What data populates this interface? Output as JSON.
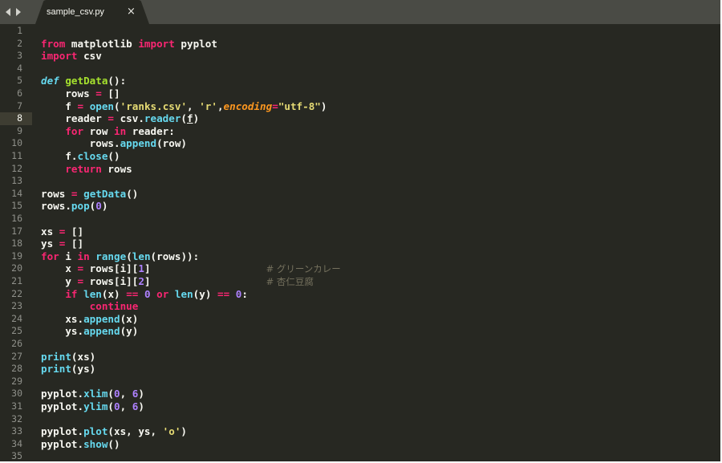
{
  "tab": {
    "filename": "sample_csv.py",
    "close_glyph": "×"
  },
  "editor": {
    "current_line": 8,
    "lines": [
      [],
      [
        [
          "kw",
          "from"
        ],
        [
          "tx",
          " matplotlib "
        ],
        [
          "kw",
          "import"
        ],
        [
          "tx",
          " pyplot"
        ]
      ],
      [
        [
          "kw",
          "import"
        ],
        [
          "tx",
          " csv"
        ]
      ],
      [],
      [
        [
          "df",
          "def"
        ],
        [
          "tx",
          " "
        ],
        [
          "dn",
          "getData"
        ],
        [
          "tx",
          "():"
        ]
      ],
      [
        [
          "tx",
          "    rows "
        ],
        [
          "kw",
          "="
        ],
        [
          "tx",
          " []"
        ]
      ],
      [
        [
          "tx",
          "    f "
        ],
        [
          "kw",
          "="
        ],
        [
          "tx",
          " "
        ],
        [
          "fn",
          "open"
        ],
        [
          "tx",
          "("
        ],
        [
          "st",
          "'ranks.csv'"
        ],
        [
          "tx",
          ", "
        ],
        [
          "st",
          "'r'"
        ],
        [
          "tx",
          ","
        ],
        [
          "pa",
          "encoding"
        ],
        [
          "kw",
          "="
        ],
        [
          "st",
          "\"utf-8\""
        ],
        [
          "tx",
          ")"
        ]
      ],
      [
        [
          "tx",
          "    reader "
        ],
        [
          "kw",
          "="
        ],
        [
          "tx",
          " csv."
        ],
        [
          "fn",
          "reader"
        ],
        [
          "tx",
          "("
        ],
        [
          "ul",
          "f"
        ],
        [
          "tx",
          ")"
        ]
      ],
      [
        [
          "tx",
          "    "
        ],
        [
          "kw",
          "for"
        ],
        [
          "tx",
          " row "
        ],
        [
          "kw",
          "in"
        ],
        [
          "tx",
          " reader:"
        ]
      ],
      [
        [
          "tx",
          "        rows."
        ],
        [
          "fn",
          "append"
        ],
        [
          "tx",
          "(row)"
        ]
      ],
      [
        [
          "tx",
          "    f."
        ],
        [
          "fn",
          "close"
        ],
        [
          "tx",
          "()"
        ]
      ],
      [
        [
          "tx",
          "    "
        ],
        [
          "kw",
          "return"
        ],
        [
          "tx",
          " rows"
        ]
      ],
      [],
      [
        [
          "tx",
          "rows "
        ],
        [
          "kw",
          "="
        ],
        [
          "tx",
          " "
        ],
        [
          "fn",
          "getData"
        ],
        [
          "tx",
          "()"
        ]
      ],
      [
        [
          "tx",
          "rows."
        ],
        [
          "fn",
          "pop"
        ],
        [
          "tx",
          "("
        ],
        [
          "nu",
          "0"
        ],
        [
          "tx",
          ")"
        ]
      ],
      [],
      [
        [
          "tx",
          "xs "
        ],
        [
          "kw",
          "="
        ],
        [
          "tx",
          " []"
        ]
      ],
      [
        [
          "tx",
          "ys "
        ],
        [
          "kw",
          "="
        ],
        [
          "tx",
          " []"
        ]
      ],
      [
        [
          "kw",
          "for"
        ],
        [
          "tx",
          " i "
        ],
        [
          "kw",
          "in"
        ],
        [
          "tx",
          " "
        ],
        [
          "fn",
          "range"
        ],
        [
          "tx",
          "("
        ],
        [
          "fn",
          "len"
        ],
        [
          "tx",
          "(rows)):"
        ]
      ],
      [
        [
          "tx",
          "    x "
        ],
        [
          "kw",
          "="
        ],
        [
          "tx",
          " rows[i]["
        ],
        [
          "nu",
          "1"
        ],
        [
          "tx",
          "]                   "
        ],
        [
          "cm",
          "# グリーンカレー"
        ]
      ],
      [
        [
          "tx",
          "    y "
        ],
        [
          "kw",
          "="
        ],
        [
          "tx",
          " rows[i]["
        ],
        [
          "nu",
          "2"
        ],
        [
          "tx",
          "]                   "
        ],
        [
          "cm",
          "# 杏仁豆腐"
        ]
      ],
      [
        [
          "tx",
          "    "
        ],
        [
          "kw",
          "if"
        ],
        [
          "tx",
          " "
        ],
        [
          "fn",
          "len"
        ],
        [
          "tx",
          "(x) "
        ],
        [
          "kw",
          "=="
        ],
        [
          "tx",
          " "
        ],
        [
          "nu",
          "0"
        ],
        [
          "tx",
          " "
        ],
        [
          "kw",
          "or"
        ],
        [
          "tx",
          " "
        ],
        [
          "fn",
          "len"
        ],
        [
          "tx",
          "(y) "
        ],
        [
          "kw",
          "=="
        ],
        [
          "tx",
          " "
        ],
        [
          "nu",
          "0"
        ],
        [
          "tx",
          ":"
        ]
      ],
      [
        [
          "tx",
          "        "
        ],
        [
          "kw",
          "continue"
        ]
      ],
      [
        [
          "tx",
          "    xs."
        ],
        [
          "fn",
          "append"
        ],
        [
          "tx",
          "(x)"
        ]
      ],
      [
        [
          "tx",
          "    ys."
        ],
        [
          "fn",
          "append"
        ],
        [
          "tx",
          "(y)"
        ]
      ],
      [],
      [
        [
          "fn",
          "print"
        ],
        [
          "tx",
          "(xs)"
        ]
      ],
      [
        [
          "fn",
          "print"
        ],
        [
          "tx",
          "(ys)"
        ]
      ],
      [],
      [
        [
          "tx",
          "pyplot."
        ],
        [
          "fn",
          "xlim"
        ],
        [
          "tx",
          "("
        ],
        [
          "nu",
          "0"
        ],
        [
          "tx",
          ", "
        ],
        [
          "nu",
          "6"
        ],
        [
          "tx",
          ")"
        ]
      ],
      [
        [
          "tx",
          "pyplot."
        ],
        [
          "fn",
          "ylim"
        ],
        [
          "tx",
          "("
        ],
        [
          "nu",
          "0"
        ],
        [
          "tx",
          ", "
        ],
        [
          "nu",
          "6"
        ],
        [
          "tx",
          ")"
        ]
      ],
      [],
      [
        [
          "tx",
          "pyplot."
        ],
        [
          "fn",
          "plot"
        ],
        [
          "tx",
          "(xs, ys, "
        ],
        [
          "st",
          "'o'"
        ],
        [
          "tx",
          ")"
        ]
      ],
      [
        [
          "tx",
          "pyplot."
        ],
        [
          "fn",
          "show"
        ],
        [
          "tx",
          "()"
        ]
      ],
      []
    ]
  },
  "colors": {
    "background": "#272822",
    "tab_bar": "#4a4b45",
    "keyword": "#f92672",
    "string": "#e6db74",
    "number": "#ae81ff",
    "builtin": "#66d9ef",
    "function_name": "#a6e22e",
    "parameter": "#fd971f",
    "comment": "#75715e"
  }
}
